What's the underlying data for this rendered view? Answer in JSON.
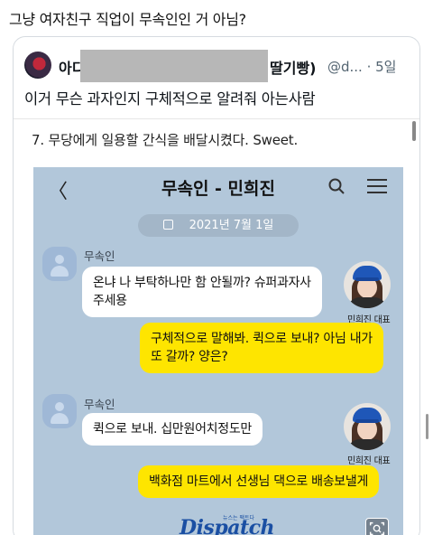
{
  "post": {
    "text": "그냥 여자친구 직업이 무속인인 거 아님?"
  },
  "quote": {
    "name_prefix": "아디",
    "name_suffix": "딸기빵)",
    "handle_time": "@d... · 5일",
    "text": "이거 무슨 과자인지 구체적으로 알려줘 아는사람"
  },
  "embedded": {
    "caption": "7. 무당에게 일용할 간식을 배달시켰다. Sweet.",
    "chat": {
      "back_glyph": "〈",
      "title": "무속인 - 민희진",
      "date": "2021년 7월 1일",
      "messages": [
        {
          "side": "left",
          "sender": "무속인",
          "text_lines": [
            "온냐 나 부탁하나만 함 안될까? 슈퍼과자사",
            "주세용"
          ]
        },
        {
          "side": "right",
          "sender": "민희진 대표",
          "text_lines": [
            "구체적으로 말해봐. 퀵으로 보내? 아님 내가",
            "또 갈까? 양은?"
          ]
        },
        {
          "side": "left",
          "sender": "무속인",
          "text_lines": [
            "퀵으로 보내. 십만원어치정도만"
          ]
        },
        {
          "side": "right",
          "sender": "민희진 대표",
          "text_lines": [
            "백화점 마트에서 선생님 댁으로 배송보낼게"
          ]
        }
      ],
      "watermark": "Dispatch",
      "watermark_tag": "뉴스는 팩트다"
    }
  },
  "colors": {
    "chat_bg": "#b2c7da",
    "my_bubble": "#fee500",
    "their_bubble": "#ffffff",
    "dispatch_blue": "#1a4fa3"
  },
  "icons": [
    "back-icon",
    "search-icon",
    "menu-icon",
    "calendar-icon",
    "default-avatar-icon",
    "zoom-icon"
  ]
}
